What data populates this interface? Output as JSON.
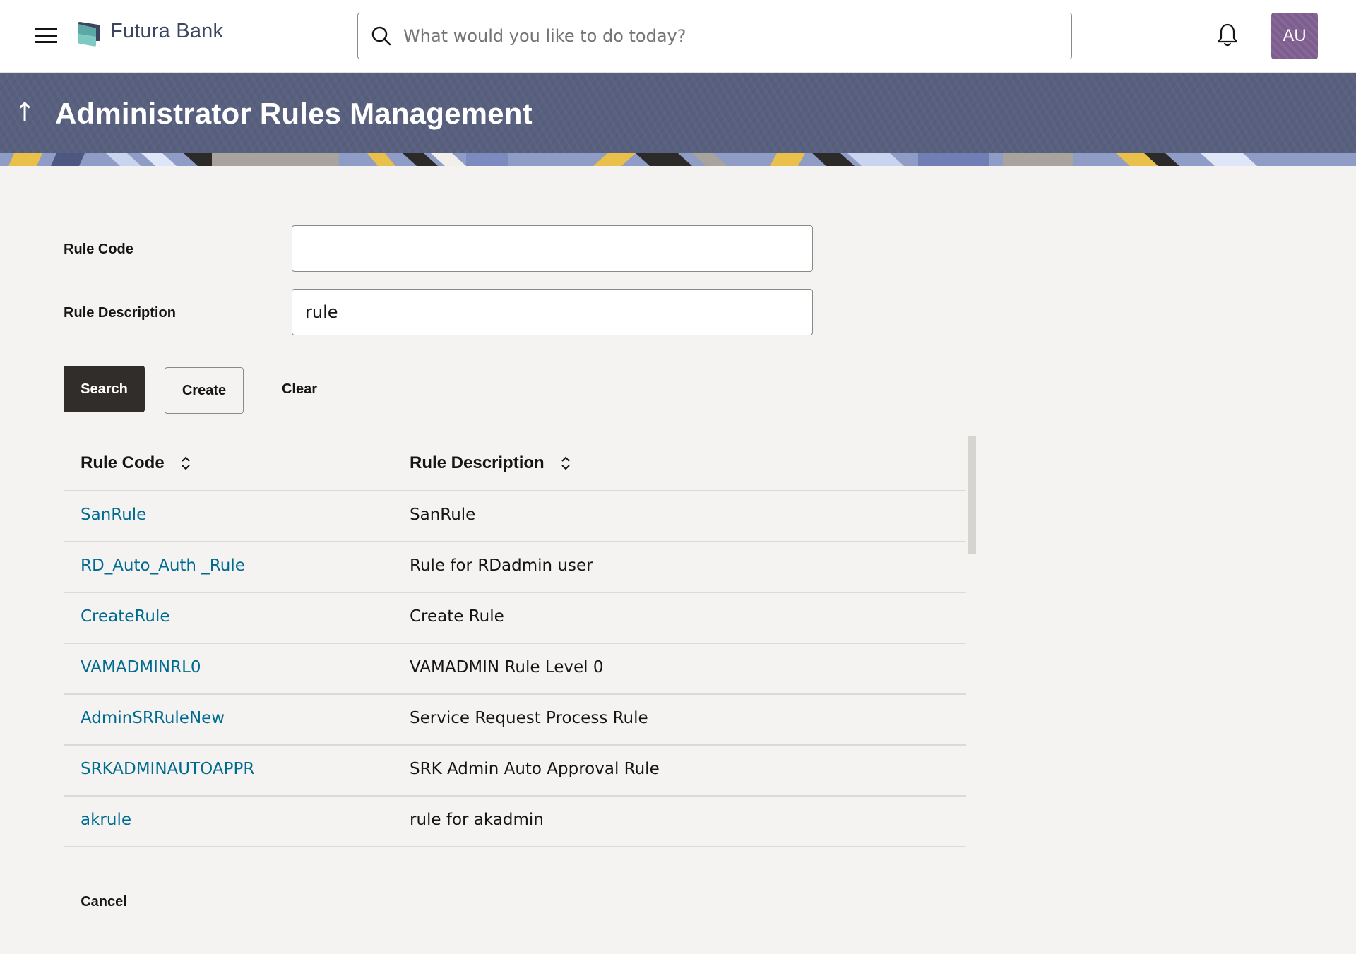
{
  "header": {
    "brand": "Futura Bank",
    "search_placeholder": "What would you like to do today?",
    "search_value": "",
    "avatar_initials": "AU",
    "icons": [
      "hamburger-menu-icon",
      "logo-icon",
      "search-icon",
      "bell-icon"
    ]
  },
  "banner": {
    "title": "Administrator Rules Management",
    "back_glyph": "↑"
  },
  "form": {
    "rule_code_label": "Rule Code",
    "rule_code_value": "",
    "rule_description_label": "Rule Description",
    "rule_description_value": "rule"
  },
  "actions": {
    "search_label": "Search",
    "create_label": "Create",
    "clear_label": "Clear",
    "cancel_label": "Cancel"
  },
  "table": {
    "columns": [
      {
        "label": "Rule Code",
        "sortable": true
      },
      {
        "label": "Rule Description",
        "sortable": true
      }
    ],
    "rows": [
      {
        "code": "SanRule",
        "description": "SanRule"
      },
      {
        "code": "RD_Auto_Auth _Rule",
        "description": "Rule for RDadmin user"
      },
      {
        "code": "CreateRule",
        "description": "Create Rule"
      },
      {
        "code": "VAMADMINRL0",
        "description": "VAMADMIN Rule Level 0"
      },
      {
        "code": "AdminSRRuleNew",
        "description": "Service Request Process Rule"
      },
      {
        "code": "SRKADMINAUTOAPPR",
        "description": "SRK Admin Auto Approval Rule"
      },
      {
        "code": "akrule",
        "description": "rule for akadmin"
      }
    ]
  },
  "colors": {
    "banner": "#58607f",
    "link": "#006b8f",
    "primary_button": "#312d2a",
    "avatar": "#7e5e8f",
    "page_background": "#f4f3f1"
  }
}
